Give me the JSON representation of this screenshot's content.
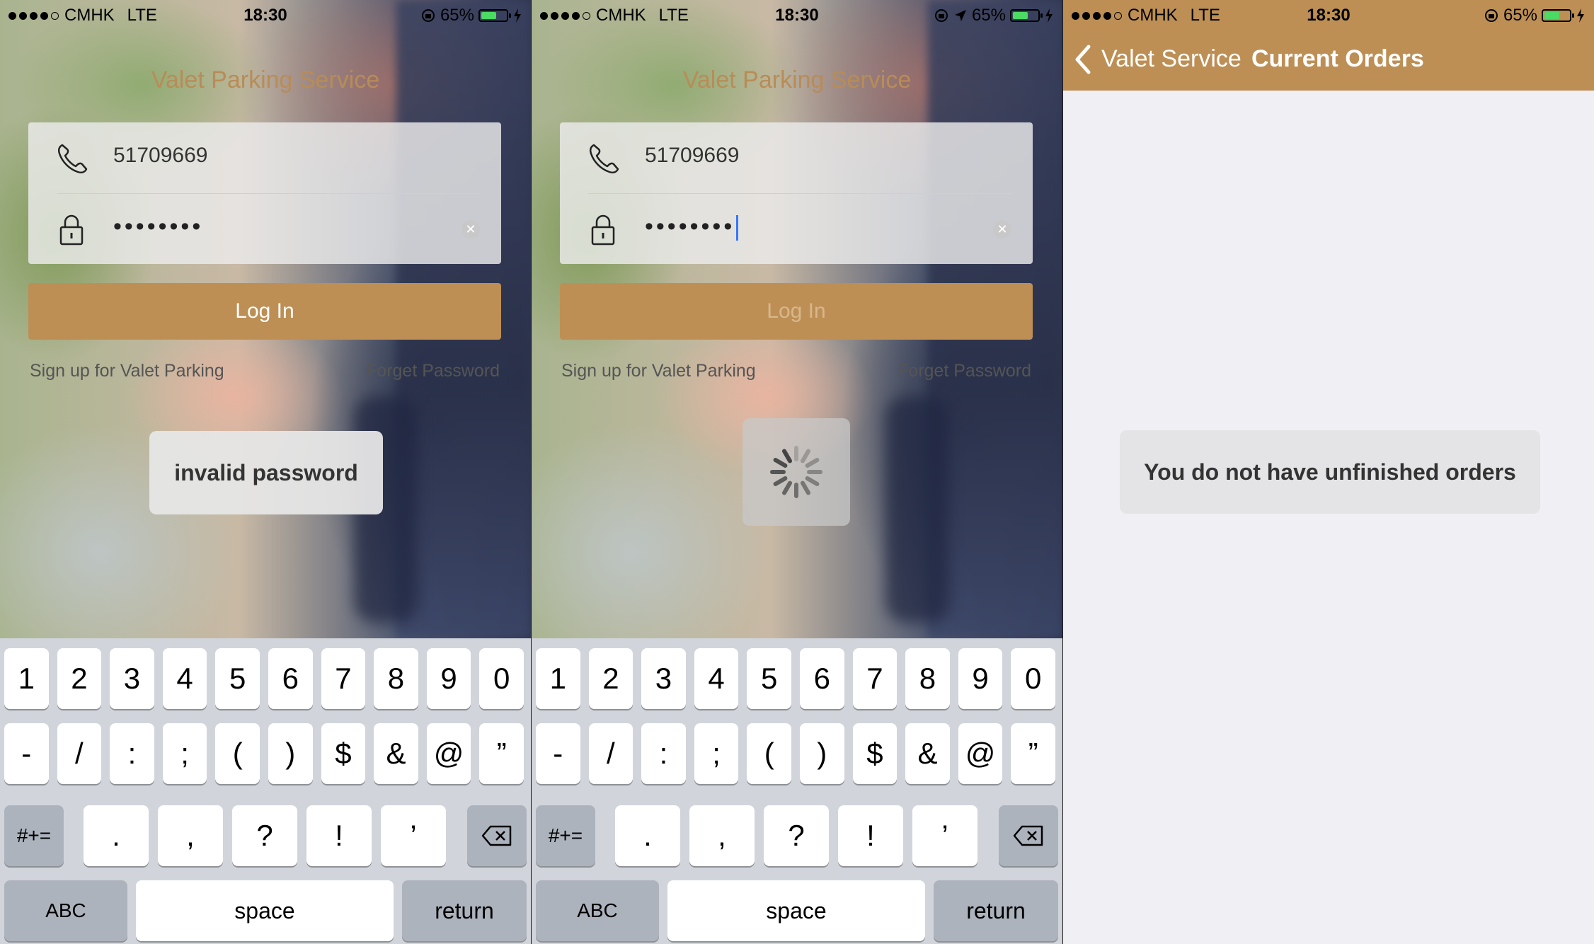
{
  "status_bar": {
    "carrier": "CMHK",
    "network": "LTE",
    "time": "18:30",
    "battery": "65%",
    "battery_level": 0.65
  },
  "login": {
    "title": "Valet Parking Service",
    "phone_value": "51709669",
    "password_mask": "••••••••",
    "login_label": "Log In",
    "signup_link": "Sign up for Valet Parking",
    "forgot_link": "Forget Password",
    "error_toast": "invalid password"
  },
  "keyboard": {
    "row1": [
      "1",
      "2",
      "3",
      "4",
      "5",
      "6",
      "7",
      "8",
      "9",
      "0"
    ],
    "row2": [
      "-",
      "/",
      ":",
      ";",
      "(",
      ")",
      "$",
      "&",
      "@",
      "”"
    ],
    "row3": [
      ".",
      ",",
      "?",
      "!",
      "’"
    ],
    "symbols_key": "#+=",
    "abc_key": "ABC",
    "space_key": "space",
    "return_key": "return"
  },
  "orders": {
    "back_label": "Valet Service",
    "nav_title": "Current Orders",
    "empty_message": "You do not have unfinished orders"
  },
  "colors": {
    "accent": "#bd8f55",
    "title_text": "#b88c57",
    "background_gray": "#efeff4"
  }
}
